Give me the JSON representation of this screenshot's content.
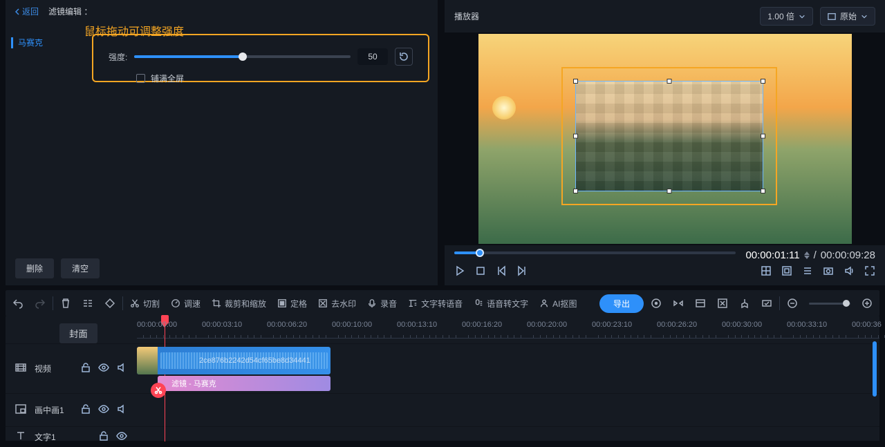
{
  "editor": {
    "back": "返回",
    "title": "滤镜编辑 ：",
    "tip": "鼠标拖动可调整强度",
    "tabs": [
      "马赛克"
    ],
    "intensity_label": "强度:",
    "intensity_value": "50",
    "fullscreen_label": "铺满全屏",
    "delete": "删除",
    "clear": "清空"
  },
  "player": {
    "title": "播放器",
    "speed": "1.00 倍",
    "display_mode": "原始",
    "current_time": "00:00:01:11",
    "sep": "/",
    "total_time": "00:00:09:28"
  },
  "toolbar": {
    "cut": "切割",
    "speed": "调速",
    "crop": "裁剪和缩放",
    "freeze": "定格",
    "watermark": "去水印",
    "record": "录音",
    "tts": "文字转语音",
    "stt": "语音转文字",
    "ai": "AI抠图",
    "export": "导出"
  },
  "timeline": {
    "cover": "封面",
    "ticks": [
      "00:00:00:00",
      "00:00:03:10",
      "00:00:06:20",
      "00:00:10:00",
      "00:00:13:10",
      "00:00:16:20",
      "00:00:20:00",
      "00:00:23:10",
      "00:00:26:20",
      "00:00:30:00",
      "00:00:33:10",
      "00:00:36"
    ],
    "tracks": {
      "video": "视频",
      "pip": "画中画1",
      "text": "文字1"
    },
    "video_clip_name": "2ce876b2242d54cf65be8d34441",
    "filter_clip_name": "滤镜 - 马赛克"
  }
}
